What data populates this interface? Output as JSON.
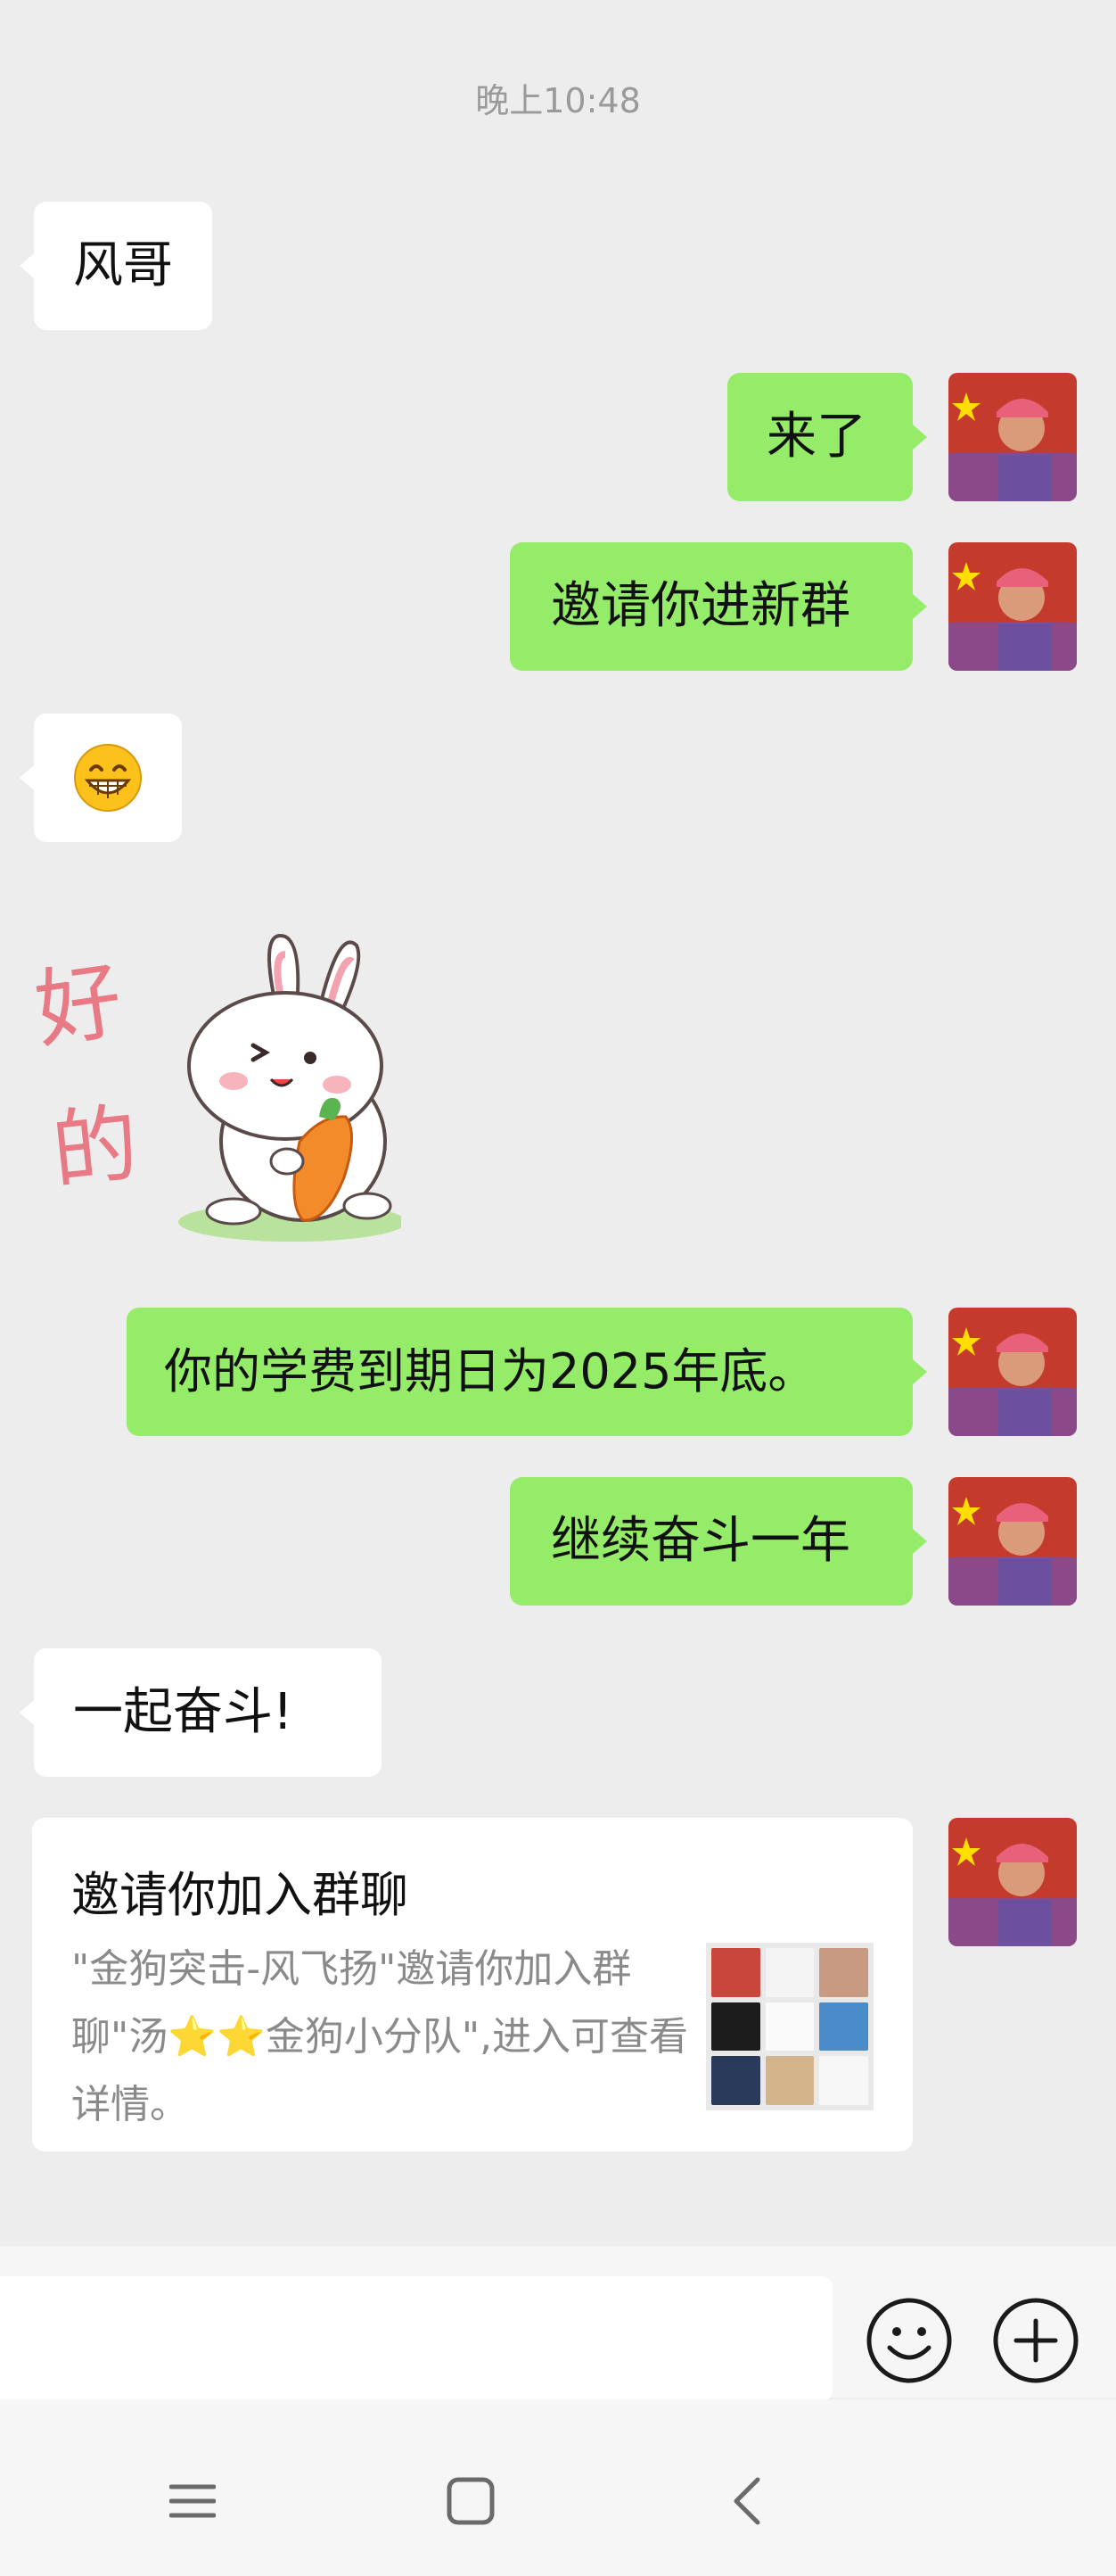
{
  "timestamp": "晚上10:48",
  "messages": {
    "m1": "风哥",
    "m2": "来了",
    "m3": "邀请你进新群",
    "m4": "😁",
    "m5_sticker": "好的",
    "m6": "你的学费到期日为2025年底。",
    "m7": "继续奋斗一年",
    "m8": "一起奋斗!"
  },
  "invite_card": {
    "title": "邀请你加入群聊",
    "desc_part1": "\"金狗突击-风飞扬\"邀请你加入群聊\"汤",
    "desc_stars": "⭐⭐",
    "desc_part2": "金狗小分队\",进入可查看详情。"
  },
  "icons": {
    "emoji_button": "smiley-face-icon",
    "plus_button": "plus-circle-icon",
    "nav_menu": "menu-icon",
    "nav_home": "home-square-icon",
    "nav_back": "back-chevron-icon"
  },
  "colors": {
    "background": "#ededed",
    "self_bubble": "#95ec69",
    "other_bubble": "#ffffff"
  }
}
